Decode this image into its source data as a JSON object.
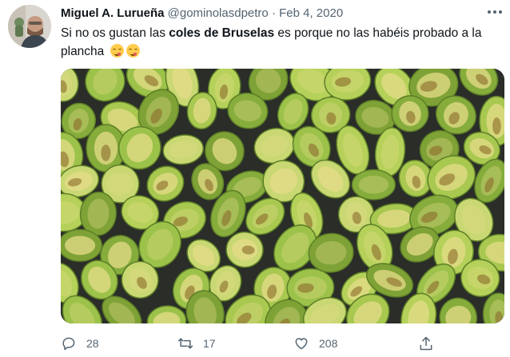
{
  "tweet": {
    "author_name": "Miguel A. Lurueña",
    "author_handle": "@gominolasdpetro",
    "separator": "·",
    "date": "Feb 4, 2020",
    "text_part1": "Si no os gustan las ",
    "text_bold": "coles de Bruselas",
    "text_part2": " es porque no las habéis probado a la plancha",
    "emojis": [
      "face-savoring-food-emoji",
      "face-savoring-food-emoji"
    ]
  },
  "actions": {
    "replies": "28",
    "retweets": "17",
    "likes": "208"
  },
  "icons": {
    "more": "more-options-icon",
    "reply": "reply-icon",
    "retweet": "retweet-icon",
    "like": "heart-icon",
    "share": "share-icon"
  },
  "colors": {
    "text": "#0f1419",
    "secondary": "#536471",
    "background": "#ffffff"
  }
}
